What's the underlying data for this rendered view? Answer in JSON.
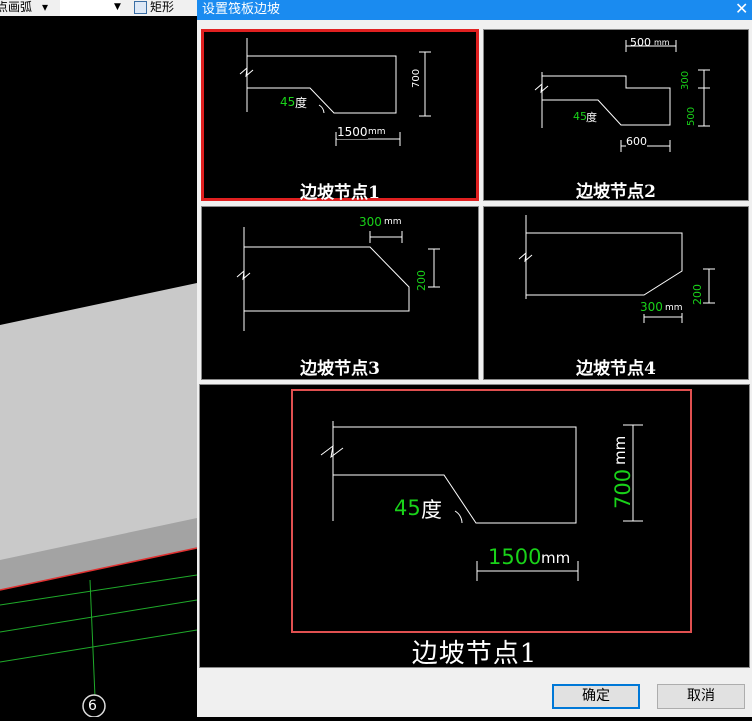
{
  "background": {
    "toolbar": {
      "arc_label": "点画弧",
      "rect_label": "矩形"
    },
    "axis_label": "6"
  },
  "dialog": {
    "title": "设置筏板边坡",
    "nodes": [
      {
        "label": "边坡节点1",
        "dims": {
          "height": "700",
          "width": "1500",
          "angle": "45",
          "unit": "mm",
          "angle_unit": "度"
        }
      },
      {
        "label": "边坡节点2",
        "dims": {
          "top": "500",
          "step": "300",
          "height": "500",
          "bottom": "600",
          "angle": "45",
          "unit": "mm",
          "angle_unit": "度"
        }
      },
      {
        "label": "边坡节点3",
        "dims": {
          "width": "300",
          "height": "200",
          "unit": "mm"
        }
      },
      {
        "label": "边坡节点4",
        "dims": {
          "width": "300",
          "height": "200",
          "unit": "mm"
        }
      }
    ],
    "selected_index": 0,
    "preview": {
      "label": "边坡节点1",
      "height": "700",
      "width": "1500",
      "angle": "45",
      "unit": "mm",
      "angle_unit": "度"
    },
    "buttons": {
      "ok": "确定",
      "cancel": "取消"
    }
  }
}
